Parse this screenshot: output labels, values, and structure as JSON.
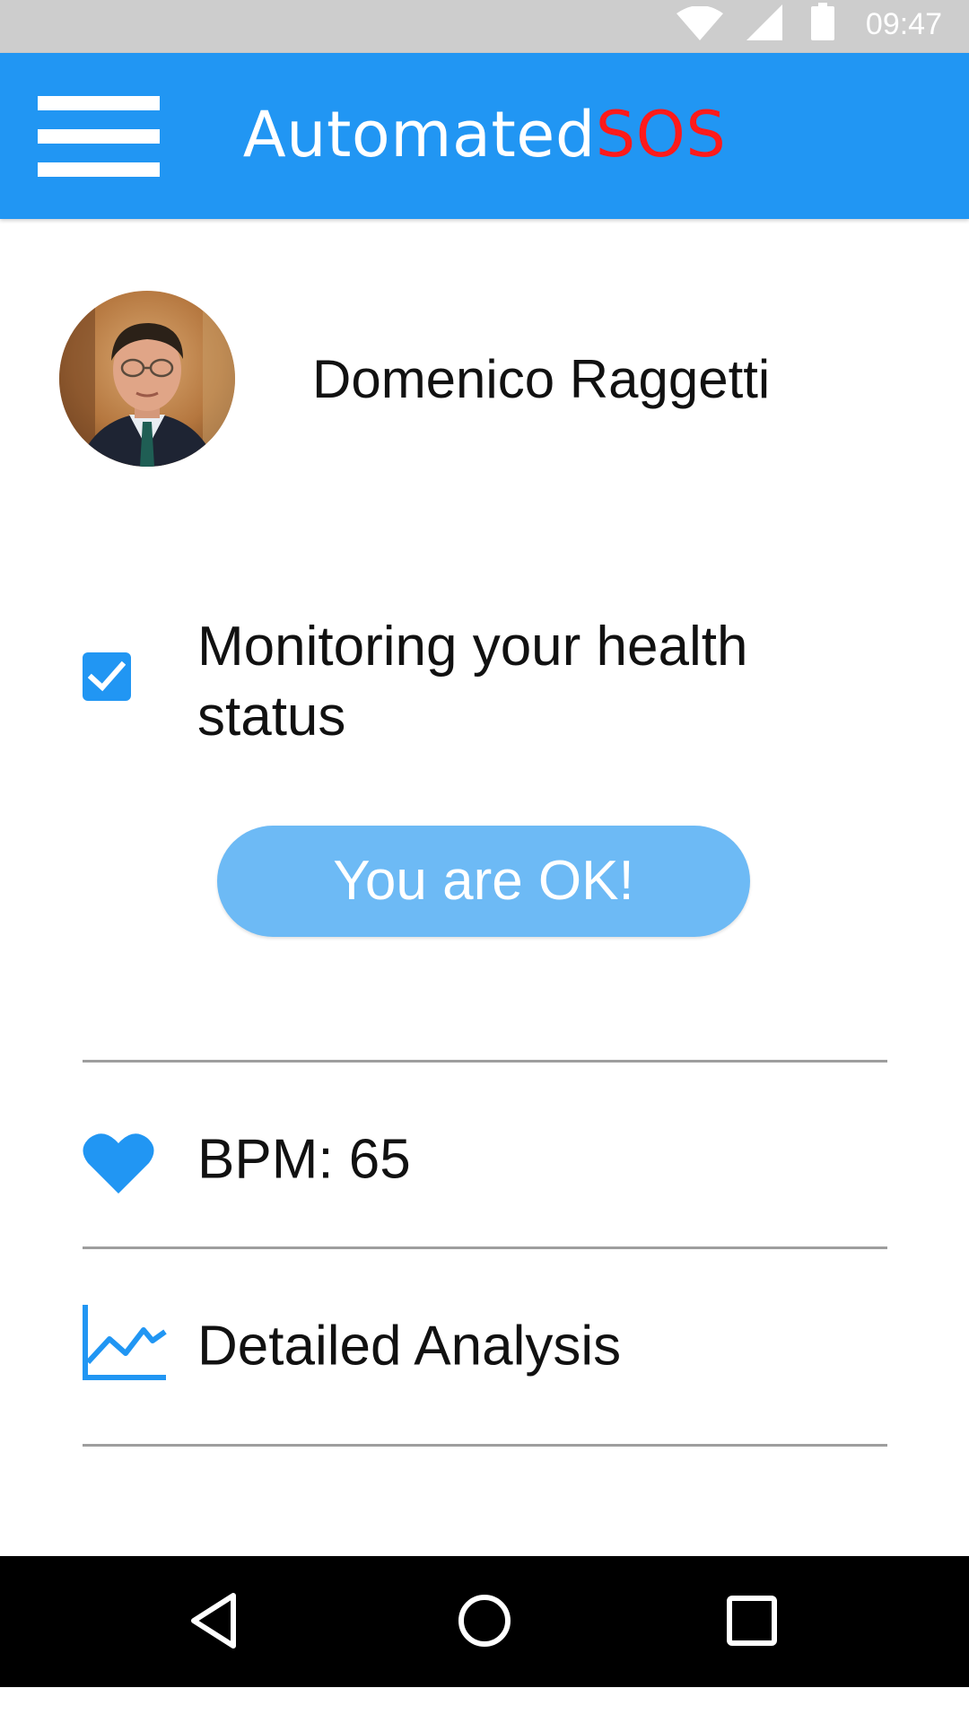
{
  "status_bar": {
    "time": "09:47",
    "icons": [
      "wifi-icon",
      "signal-icon",
      "battery-icon"
    ]
  },
  "app_bar": {
    "title_main": "Automated",
    "title_accent": "SOS",
    "menu_icon": "hamburger-menu-icon"
  },
  "profile": {
    "name": "Domenico Raggetti"
  },
  "monitoring": {
    "checked": true,
    "label": "Monitoring your health status"
  },
  "status_button": {
    "label": "You are OK!"
  },
  "metrics": {
    "bpm_label": "BPM: 65",
    "bpm_icon": "heart-icon",
    "analysis_label": "Detailed Analysis",
    "analysis_icon": "line-chart-icon"
  },
  "nav_bar": {
    "items": [
      "back-icon",
      "home-icon",
      "recents-icon"
    ]
  },
  "colors": {
    "primary": "#2196f3",
    "accent": "#ff1a1a",
    "button": "#6dbaf5",
    "status_bar": "#cdcdcd",
    "nav_bar": "#000000"
  }
}
